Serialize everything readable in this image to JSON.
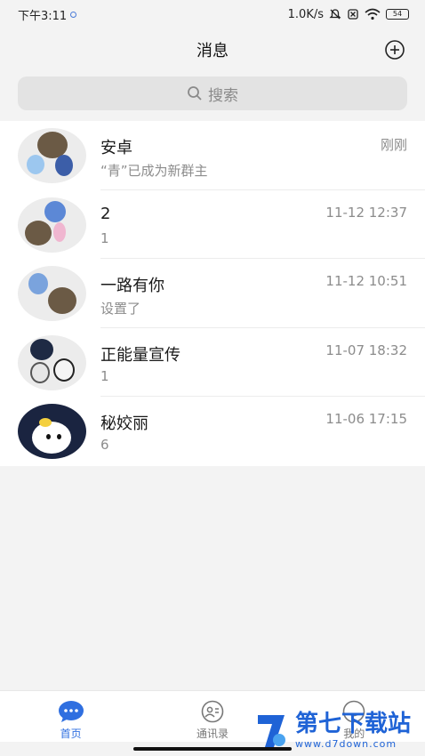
{
  "status_bar": {
    "time": "下午3:11",
    "network_speed": "1.0K/s",
    "battery": "54"
  },
  "header": {
    "title": "消息"
  },
  "search": {
    "placeholder": "搜索"
  },
  "conversations": [
    {
      "name": "安卓",
      "message": "“青”已成为新群主",
      "time": "刚刚"
    },
    {
      "name": "2",
      "message": "1",
      "time": "11-12 12:37"
    },
    {
      "name": "一路有你",
      "message": "设置了",
      "time": "11-12 10:51"
    },
    {
      "name": "正能量宣传",
      "message": "1",
      "time": "11-07 18:32"
    },
    {
      "name": "秘姣丽",
      "message": "6",
      "time": "11-06 17:15"
    }
  ],
  "tabbar": {
    "home": "首页",
    "contacts": "通讯录",
    "mine": "我的"
  },
  "watermark": {
    "text": "第七下载站",
    "url": "www.d7down.com"
  },
  "colors": {
    "accent": "#2f6fe0",
    "background": "#f3f3f3"
  }
}
